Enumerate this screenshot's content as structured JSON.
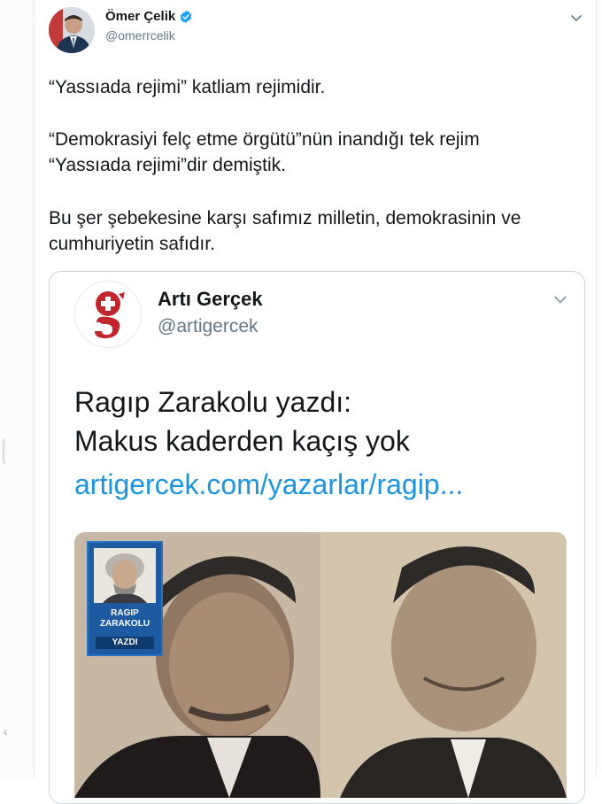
{
  "tweet": {
    "author_name": "Ömer Çelik",
    "author_handle": "@omerrcelik",
    "paragraphs": [
      "“Yassıada rejimi” katliam rejimidir.",
      "“Demokrasiyi felç etme örgütü”nün inandığı tek rejim",
      "“Yassıada rejimi”dir demiştik.",
      "Bu şer şebekesine karşı safımız milletin, demokrasinin ve",
      "cumhuriyetin safıdır."
    ]
  },
  "quoted_tweet": {
    "author_name": "Artı Gerçek",
    "author_handle": "@artigercek",
    "line1": "Ragıp Zarakolu yazdı:",
    "line2": "Makus kaderden kaçış yok",
    "link": "artigercek.com/yazarlar/ragip...",
    "badge": {
      "name_line1": "RAGIP",
      "name_line2": "ZARAKOLU",
      "label": "YAZDI"
    }
  },
  "icons": {
    "verified": "verified-badge-icon",
    "chevron": "chevron-down-icon"
  },
  "colors": {
    "link": "#1b95e0",
    "verified": "#1da1f2",
    "logo": "#c0272d"
  }
}
